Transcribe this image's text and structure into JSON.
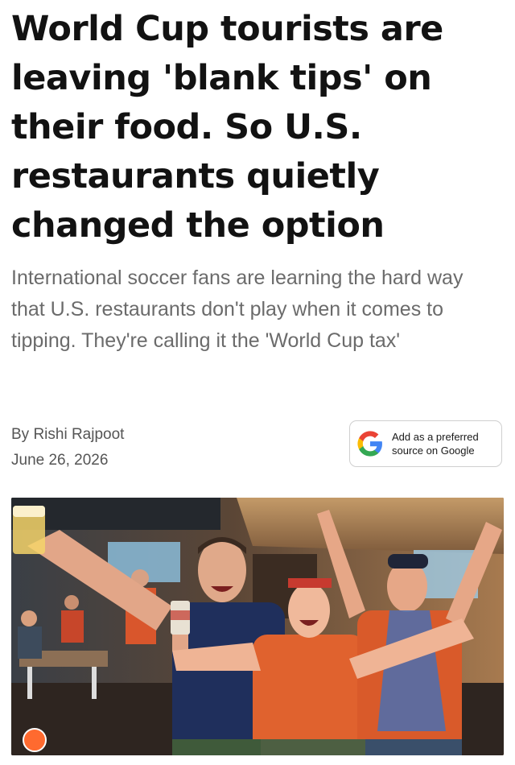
{
  "article": {
    "headline": "World Cup tourists are leaving 'blank tips' on their food. So U.S. restaurants quietly changed the option",
    "subheadline": "International soccer fans are learning the hard way that U.S. restaurants don't play when it comes to tipping. They're calling it the 'World Cup tax'",
    "byline": "By Rishi Rajpoot",
    "date": "June 26, 2026"
  },
  "preferred_source": {
    "line1": "Add as a preferred",
    "line2": "source on Google",
    "icon": "google-g-icon"
  },
  "photo": {
    "subject": "Scotland fans celebrating in a sports bar",
    "badge_icon": "publisher-logo-icon",
    "colors": {
      "jersey_orange": "#e0622e",
      "jersey_navy": "#1f2f5c"
    }
  }
}
